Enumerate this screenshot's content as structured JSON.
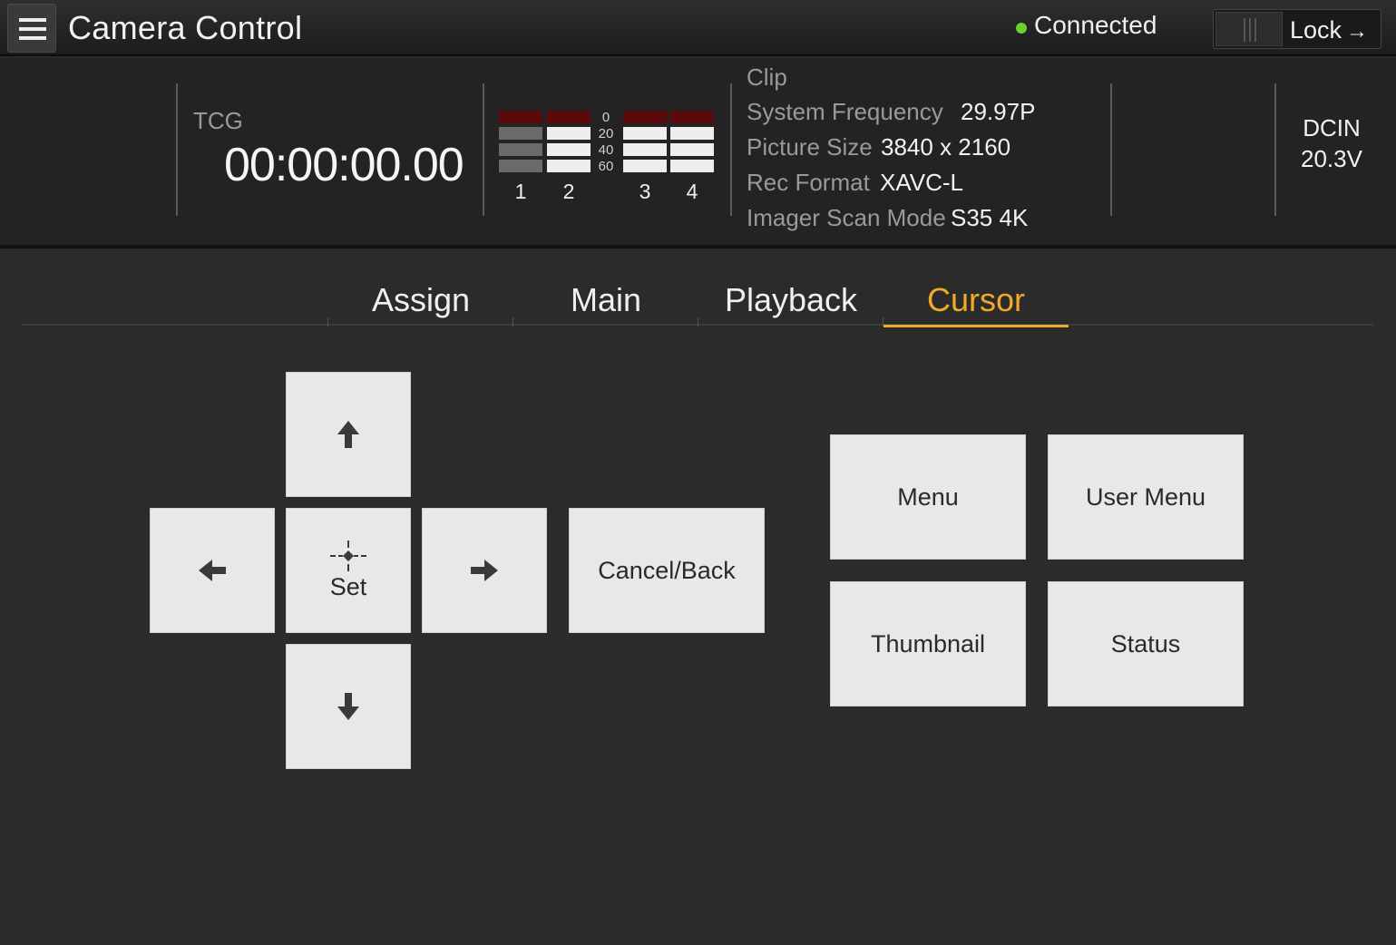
{
  "header": {
    "title": "Camera Control",
    "connection_status": "Connected",
    "connection_color": "#6ad12e",
    "lock_label": "Lock",
    "lock_icon": "→"
  },
  "status": {
    "tcg_label": "TCG",
    "tcg_value": "00:00:00.00",
    "audio_meter": {
      "scale": [
        "0",
        "20",
        "40",
        "60"
      ],
      "channels": [
        {
          "label": "1",
          "level": 0
        },
        {
          "label": "2",
          "level": 3
        },
        {
          "label": "3",
          "level": 3
        },
        {
          "label": "4",
          "level": 3
        }
      ]
    },
    "clip_heading": "Clip",
    "info": [
      {
        "label": "System Frequency",
        "value": "29.97P"
      },
      {
        "label": "Picture Size",
        "value": "3840 x 2160"
      },
      {
        "label": "Rec Format",
        "value": "XAVC-L"
      },
      {
        "label": "Imager Scan Mode",
        "value": "S35 4K"
      }
    ],
    "power_label": "DCIN",
    "power_value": "20.3V"
  },
  "tabs": [
    {
      "label": "Assign",
      "active": false
    },
    {
      "label": "Main",
      "active": false
    },
    {
      "label": "Playback",
      "active": false
    },
    {
      "label": "Cursor",
      "active": true
    }
  ],
  "accent_color": "#f0a92a",
  "cursor_pad": {
    "up_icon": "arrow-up-icon",
    "down_icon": "arrow-down-icon",
    "left_icon": "arrow-left-icon",
    "right_icon": "arrow-right-icon",
    "set_icon": "crosshair-icon",
    "set_label": "Set",
    "cancel_label": "Cancel/Back"
  },
  "function_buttons": {
    "menu": "Menu",
    "user_menu": "User Menu",
    "thumbnail": "Thumbnail",
    "status": "Status"
  }
}
